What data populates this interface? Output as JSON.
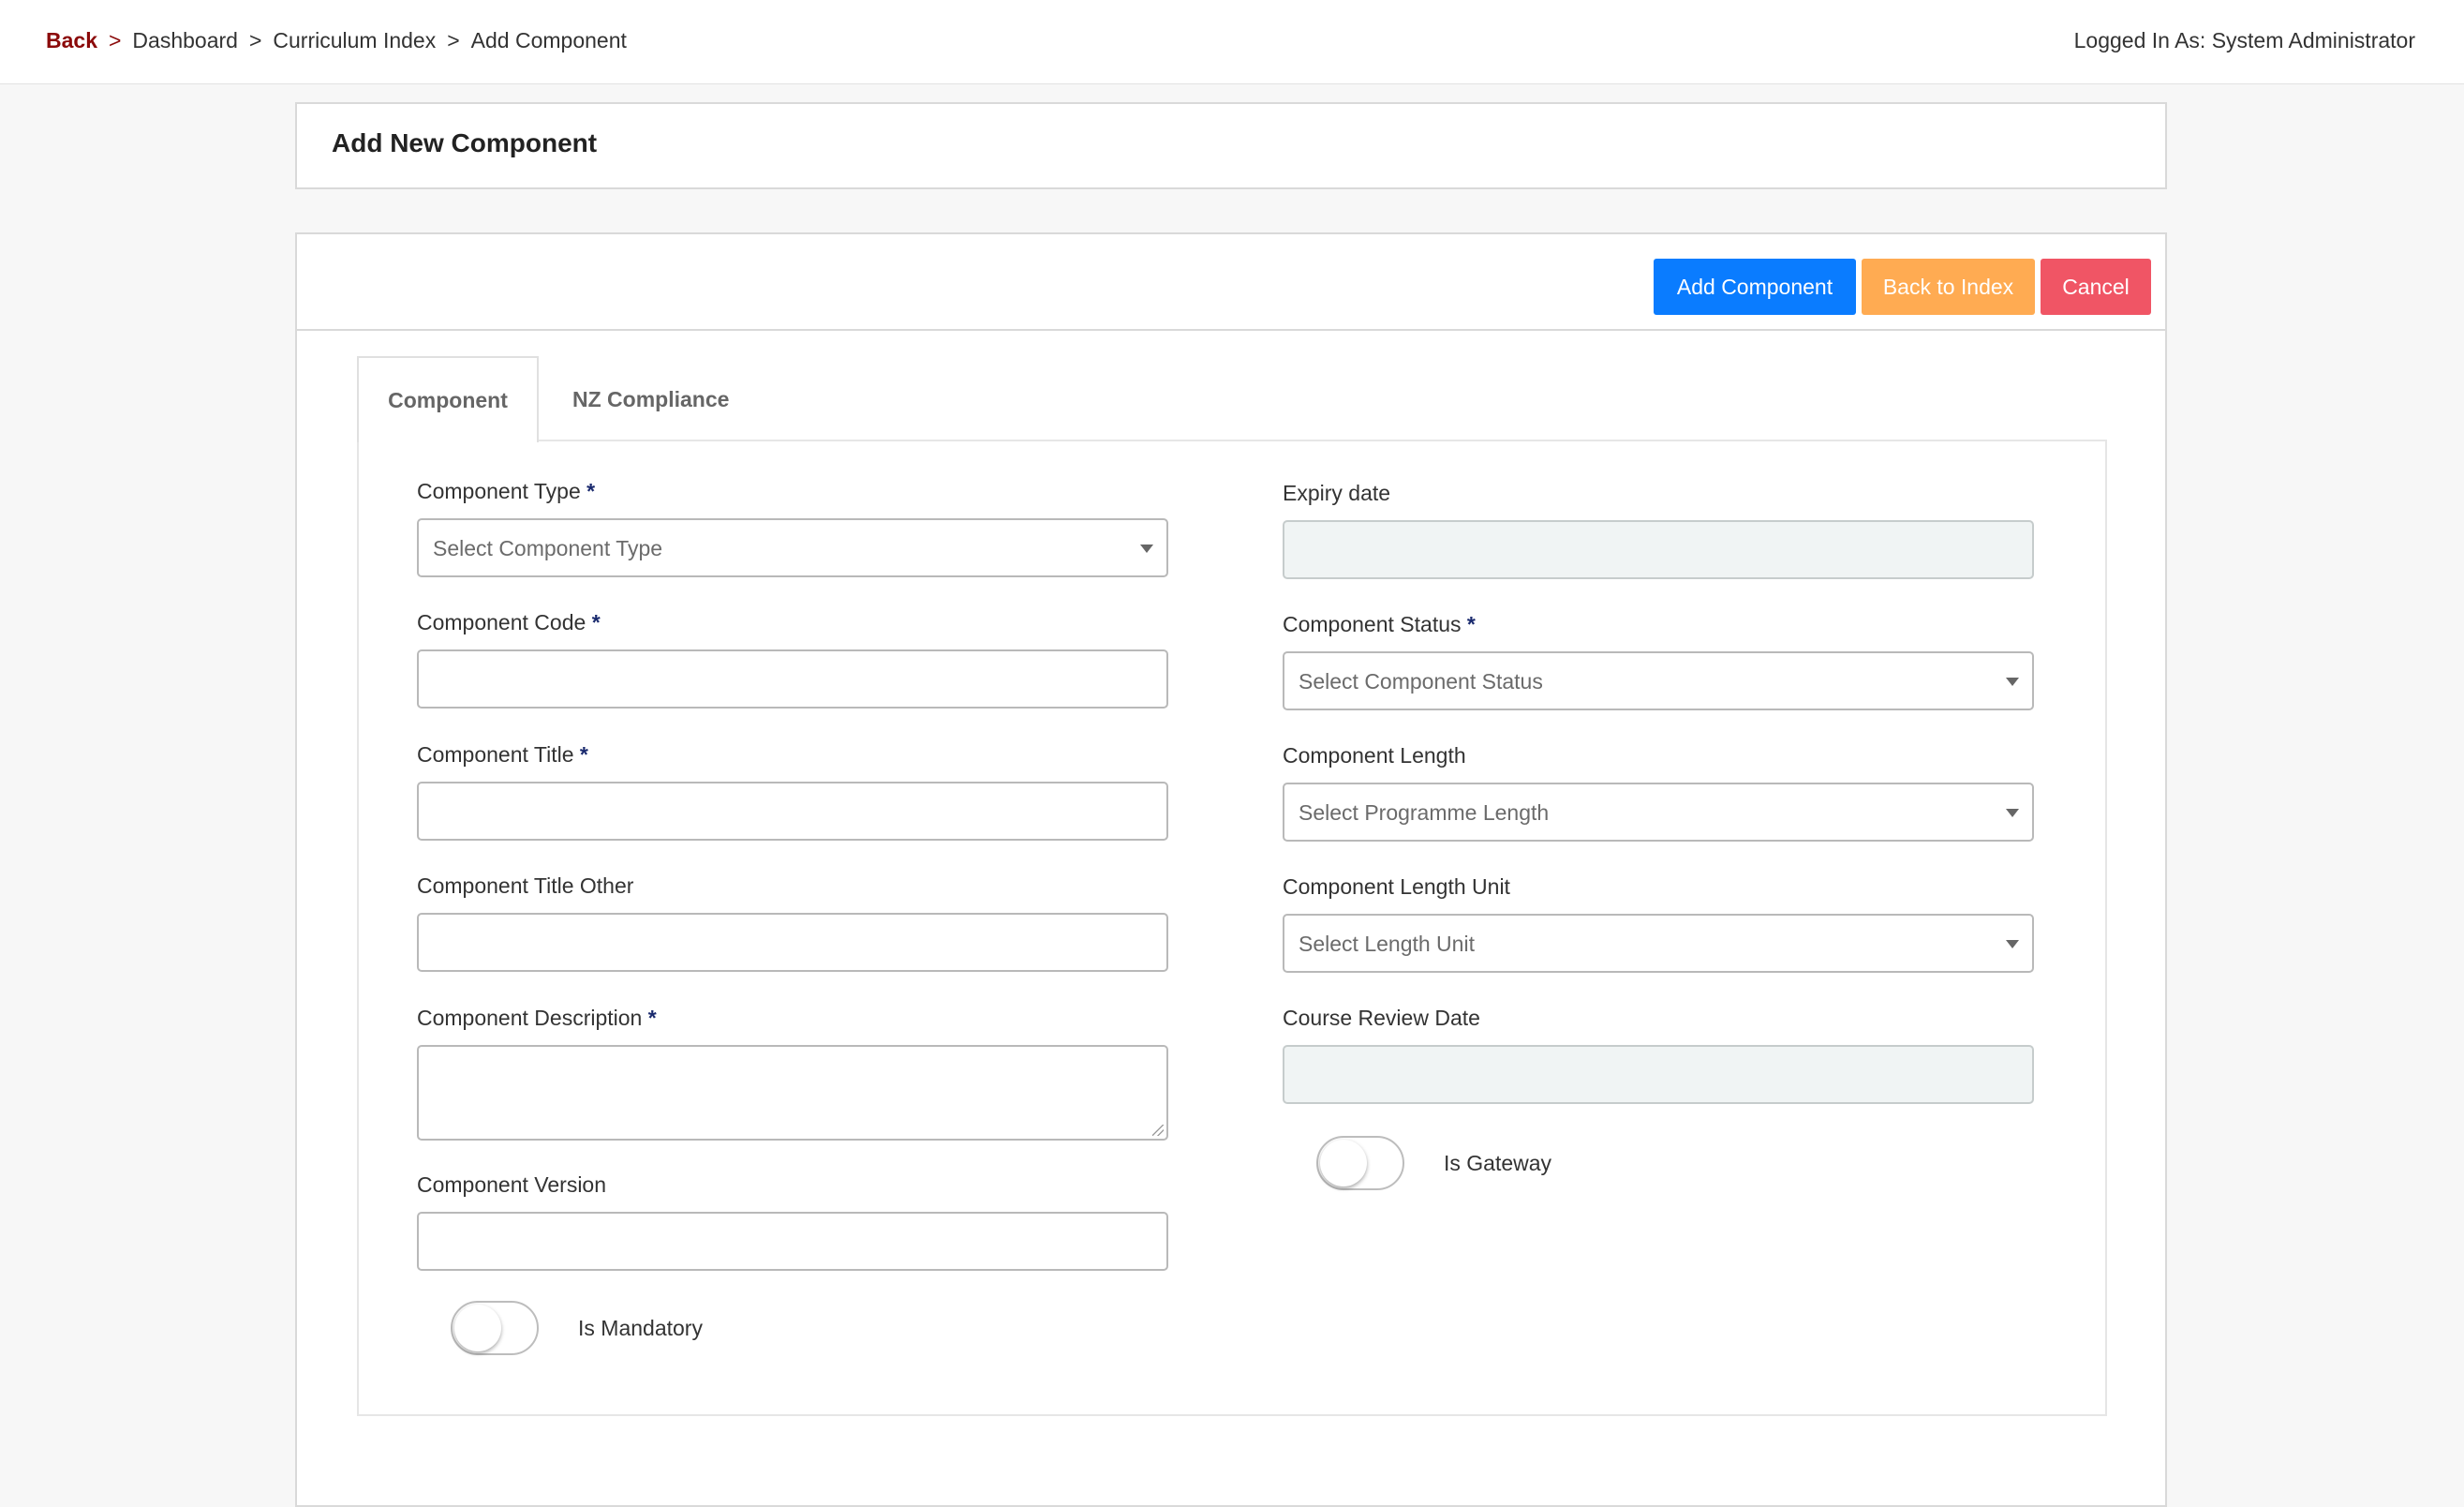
{
  "breadcrumb": {
    "back": "Back",
    "separator": ">",
    "items": [
      "Dashboard",
      "Curriculum Index",
      "Add Component"
    ]
  },
  "user": {
    "logged_in_text": "Logged In As: System Administrator"
  },
  "page": {
    "title": "Add New Component"
  },
  "toolbar": {
    "add_label": "Add Component",
    "back_label": "Back to Index",
    "cancel_label": "Cancel"
  },
  "tabs": [
    {
      "label": "Component",
      "active": true
    },
    {
      "label": "NZ Compliance",
      "active": false
    }
  ],
  "form": {
    "required_marker": "*",
    "component_type": {
      "label": "Component Type",
      "placeholder": "Select Component Type"
    },
    "component_code": {
      "label": "Component Code",
      "value": ""
    },
    "component_title": {
      "label": "Component Title",
      "value": ""
    },
    "component_title_other": {
      "label": "Component Title Other",
      "value": ""
    },
    "component_description": {
      "label": "Component Description",
      "value": ""
    },
    "component_version": {
      "label": "Component Version",
      "value": ""
    },
    "is_mandatory": {
      "label": "Is Mandatory",
      "checked": false
    },
    "expiry_date": {
      "label": "Expiry date",
      "value": ""
    },
    "component_status": {
      "label": "Component Status",
      "placeholder": "Select Component Status"
    },
    "component_length": {
      "label": "Component Length",
      "placeholder": "Select Programme Length"
    },
    "component_length_unit": {
      "label": "Component Length Unit",
      "placeholder": "Select Length Unit"
    },
    "course_review_date": {
      "label": "Course Review Date",
      "value": ""
    },
    "is_gateway": {
      "label": "Is Gateway",
      "checked": false
    }
  },
  "colors": {
    "primary": "#0a7cff",
    "warning": "#ffab52",
    "danger": "#f05565",
    "back_link": "#8b0a0a"
  }
}
